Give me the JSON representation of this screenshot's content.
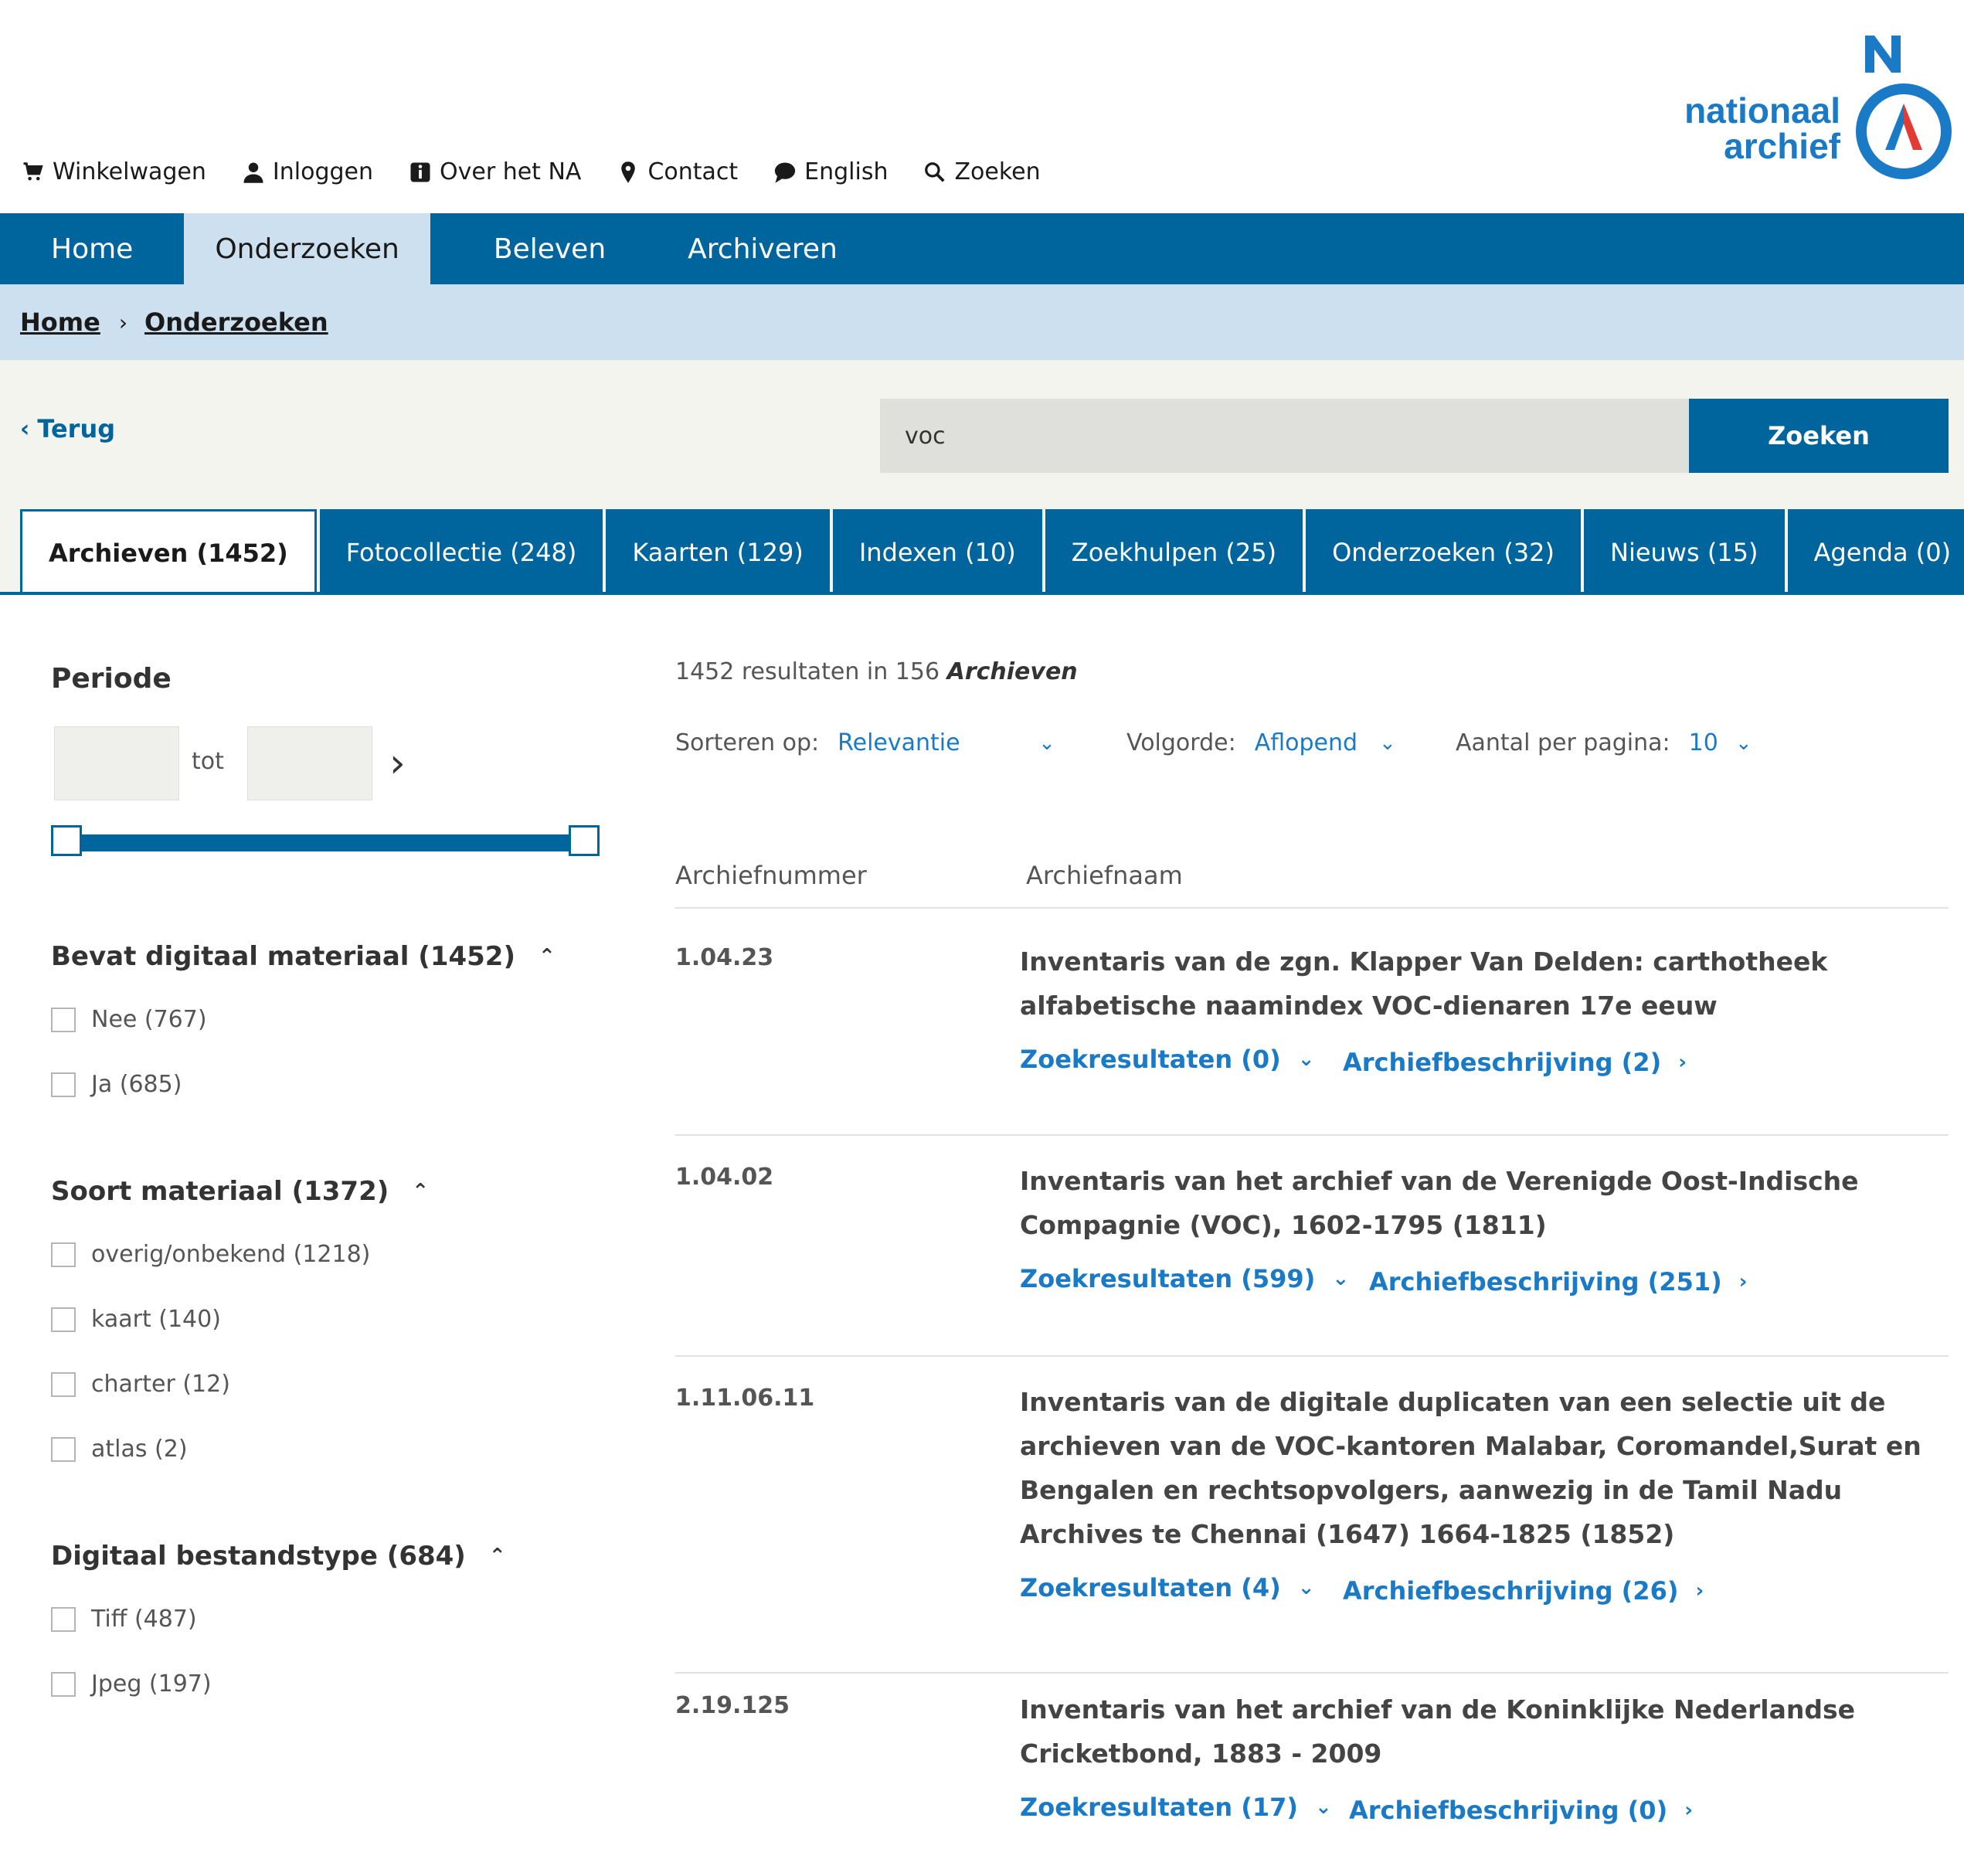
{
  "util_nav": [
    {
      "label": "Winkelwagen",
      "icon": "cart-icon"
    },
    {
      "label": "Inloggen",
      "icon": "user-icon"
    },
    {
      "label": "Over het NA",
      "icon": "info-icon"
    },
    {
      "label": "Contact",
      "icon": "location-pin-icon"
    },
    {
      "label": "English",
      "icon": "speech-bubble-icon"
    },
    {
      "label": "Zoeken",
      "icon": "search-icon"
    }
  ],
  "logo": {
    "line1": "nationaal",
    "line2": "archief",
    "brand_color": "#1a7ac6",
    "accent_red": "#e23b35"
  },
  "main_nav": {
    "items": [
      "Home",
      "Onderzoeken",
      "Beleven",
      "Archiveren"
    ],
    "active": "Onderzoeken",
    "color": "#00659d"
  },
  "breadcrumb": [
    "Home",
    "Onderzoeken"
  ],
  "search": {
    "back_label": "Terug",
    "query": "voc",
    "button_label": "Zoeken"
  },
  "tabs": [
    {
      "label": "Archieven (1452)",
      "active": true
    },
    {
      "label": "Fotocollectie (248)"
    },
    {
      "label": "Kaarten (129)"
    },
    {
      "label": "Indexen (10)"
    },
    {
      "label": "Zoekhulpen (25)"
    },
    {
      "label": "Onderzoeken (32)"
    },
    {
      "label": "Nieuws (15)"
    },
    {
      "label": "Agenda (0)"
    }
  ],
  "sidebar": {
    "periode": {
      "title": "Periode",
      "tot_label": "tot",
      "from": "",
      "to": ""
    },
    "facets": [
      {
        "title": "Bevat digitaal materiaal",
        "count": "(1452)",
        "options": [
          "Nee (767)",
          "Ja (685)"
        ]
      },
      {
        "title": "Soort materiaal",
        "count": "(1372)",
        "options": [
          "overig/onbekend (1218)",
          "kaart (140)",
          "charter (12)",
          "atlas (2)"
        ]
      },
      {
        "title": "Digitaal bestandstype",
        "count": "(684)",
        "options": [
          "Tiff (487)",
          "Jpeg (197)"
        ]
      }
    ]
  },
  "results": {
    "summary_prefix": "1452 resultaten in 156",
    "summary_em": "Archieven",
    "sort": {
      "label": "Sorteren op:",
      "value": "Relevantie"
    },
    "order": {
      "label": "Volgorde:",
      "value": "Aflopend"
    },
    "per_page": {
      "label": "Aantal per pagina:",
      "value": "10"
    },
    "columns": [
      "Archiefnummer",
      "Archiefnaam"
    ],
    "rows": [
      {
        "number": "1.04.23",
        "name": "Inventaris van de zgn. Klapper Van Delden: carthotheek alfabetische naamindex VOC-dienaren 17e eeuw",
        "zoek": "Zoekresultaten (0)",
        "beschr": "Archiefbeschrijving (2)"
      },
      {
        "number": "1.04.02",
        "name": "Inventaris van het archief van de Verenigde Oost-Indische Compagnie (VOC), 1602-1795 (1811)",
        "zoek": "Zoekresultaten (599)",
        "beschr": "Archiefbeschrijving (251)"
      },
      {
        "number": "1.11.06.11",
        "name": "Inventaris van de digitale duplicaten van een selectie uit de archieven van de VOC-kantoren Malabar, Coromandel,Surat en Bengalen en rechtsopvolgers, aanwezig in de Tamil Nadu Archives te Chennai (1647) 1664-1825 (1852)",
        "zoek": "Zoekresultaten (4)",
        "beschr": "Archiefbeschrijving (26)"
      },
      {
        "number": "2.19.125",
        "name": "Inventaris van het archief van de Koninklijke Nederlandse Cricketbond, 1883 - 2009",
        "zoek": "Zoekresultaten (17)",
        "beschr": "Archiefbeschrijving (0)"
      }
    ]
  }
}
